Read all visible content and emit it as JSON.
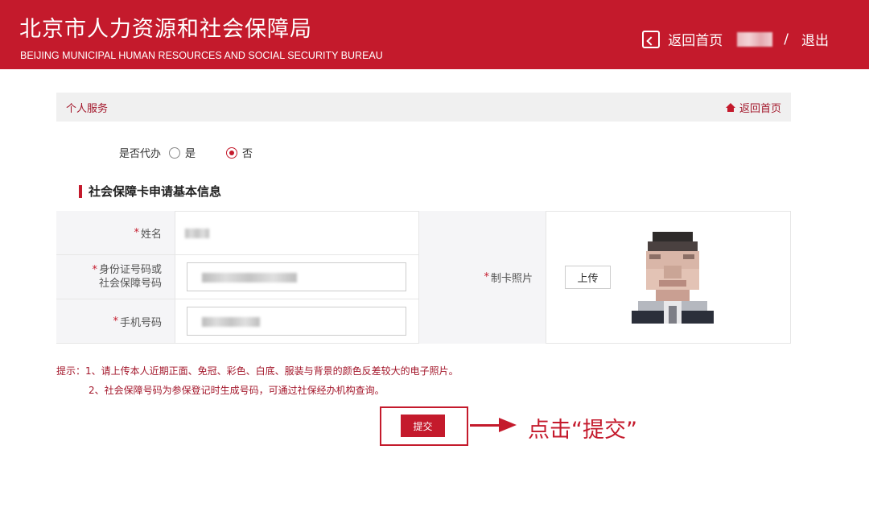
{
  "header": {
    "title": "北京市人力资源和社会保障局",
    "subtitle": "BEIJING MUNICIPAL HUMAN RESOURCES AND SOCIAL SECURITY BUREAU",
    "home_link": "返回首页",
    "separator": "/",
    "logout": "退出"
  },
  "breadcrumb": {
    "section": "个人服务",
    "home_link": "返回首页"
  },
  "agent": {
    "question": "是否代办",
    "options": [
      "是",
      "否"
    ],
    "selected": "否"
  },
  "section": {
    "title": "社会保障卡申请基本信息"
  },
  "form": {
    "required_mark": "*",
    "name_label": "姓名",
    "id_label_line1": "身份证号码或",
    "id_label_line2": "社会保障号码",
    "phone_label": "手机号码",
    "photo_label": "制卡照片",
    "upload_label": "上传"
  },
  "hints": {
    "line1": "提示：1、请上传本人近期正面、免冠、彩色、白底、服装与背景的颜色反差较大的电子照片。",
    "line2": "2、社会保障号码为参保登记时生成号码，可通过社保经办机构查询。"
  },
  "submit": {
    "label": "提交",
    "callout": "点击“提交”"
  },
  "colors": {
    "brand_red": "#c41a2c"
  }
}
